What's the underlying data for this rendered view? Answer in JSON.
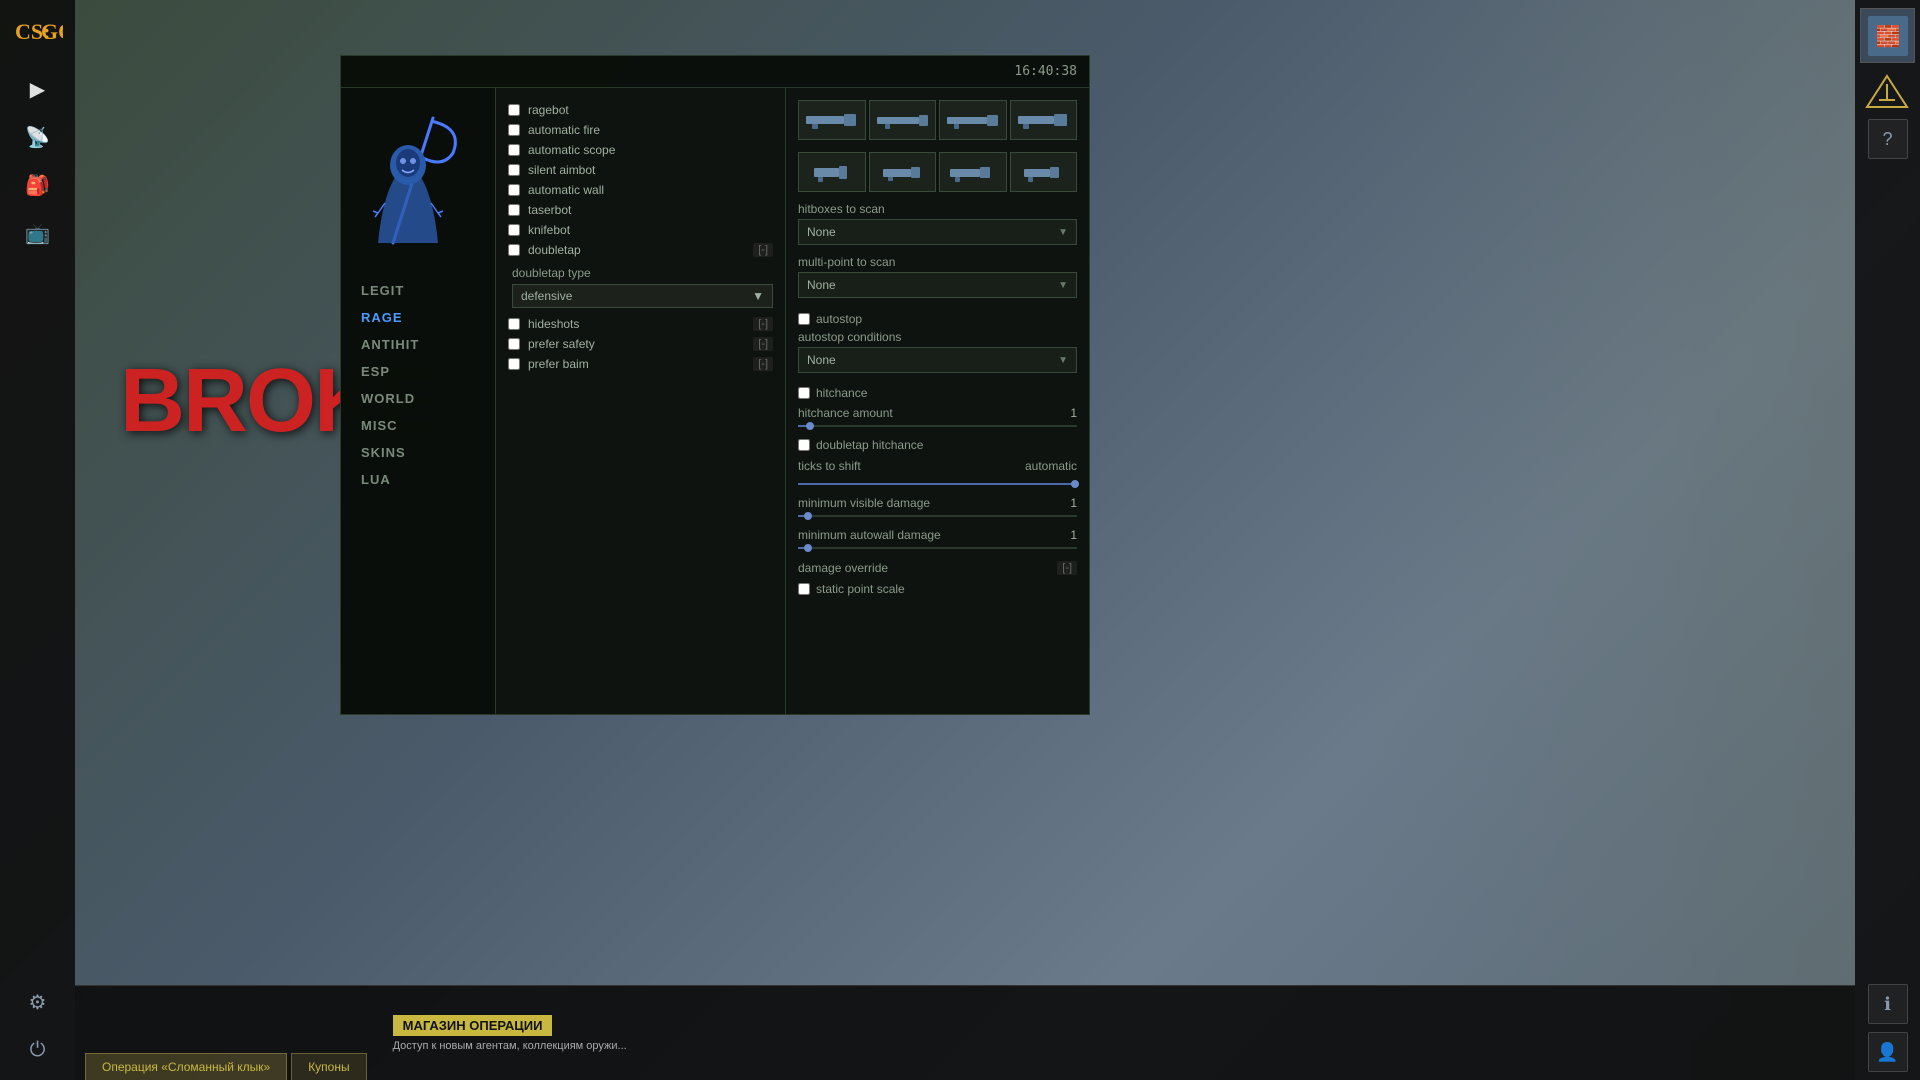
{
  "app": {
    "title": "CS:GO",
    "time": "16:40:38"
  },
  "sidebar_left": {
    "icons": [
      "▶",
      "📡",
      "🎒",
      "📺",
      "⚙",
      "⏻"
    ]
  },
  "sidebar_right": {
    "rank_icon": "≡",
    "help_icon": "?",
    "info_icon": "ℹ",
    "profile_icon": "👤"
  },
  "hacker_menu": {
    "nav": {
      "items": [
        {
          "id": "legit",
          "label": "LEGIT",
          "active": false
        },
        {
          "id": "rage",
          "label": "RAGE",
          "active": true
        },
        {
          "id": "antihit",
          "label": "ANTIHIT",
          "active": false
        },
        {
          "id": "esp",
          "label": "ESP",
          "active": false
        },
        {
          "id": "world",
          "label": "WORLD",
          "active": false
        },
        {
          "id": "misc",
          "label": "MISC",
          "active": false
        },
        {
          "id": "skins",
          "label": "SKINS",
          "active": false
        },
        {
          "id": "lua",
          "label": "LUA",
          "active": false
        }
      ]
    },
    "left_panel": {
      "checkboxes": [
        {
          "id": "ragebot",
          "label": "ragebot",
          "checked": false,
          "keybind": ""
        },
        {
          "id": "automatic_fire",
          "label": "automatic fire",
          "checked": false,
          "keybind": ""
        },
        {
          "id": "automatic_scope",
          "label": "automatic scope",
          "checked": false,
          "keybind": ""
        },
        {
          "id": "silent_aimbot",
          "label": "silent aimbot",
          "checked": false,
          "keybind": ""
        },
        {
          "id": "automatic_wall",
          "label": "automatic wall",
          "checked": false,
          "keybind": ""
        },
        {
          "id": "taserbot",
          "label": "taserbot",
          "checked": false,
          "keybind": ""
        },
        {
          "id": "knifebot",
          "label": "knifebot",
          "checked": false,
          "keybind": ""
        },
        {
          "id": "doubletap",
          "label": "doubletap",
          "checked": false,
          "keybind": "[-]"
        }
      ],
      "doubletap_type_label": "doubletap type",
      "doubletap_type_value": "defensive",
      "sub_checkboxes": [
        {
          "id": "hideshots",
          "label": "hideshots",
          "checked": false,
          "keybind": "[-]"
        },
        {
          "id": "prefer_safety",
          "label": "prefer safety",
          "checked": false,
          "keybind": "[-]"
        },
        {
          "id": "prefer_baim",
          "label": "prefer baim",
          "checked": false,
          "keybind": "[-]"
        }
      ]
    },
    "right_panel": {
      "weapons_row1": [
        {
          "id": "w1",
          "label": "rifle1",
          "active": false
        },
        {
          "id": "w2",
          "label": "rifle2",
          "active": false
        },
        {
          "id": "w3",
          "label": "rifle3",
          "active": false
        },
        {
          "id": "w4",
          "label": "rifle4",
          "active": false
        }
      ],
      "weapons_row2": [
        {
          "id": "w5",
          "label": "pistol1",
          "active": false
        },
        {
          "id": "w6",
          "label": "pistol2",
          "active": false
        },
        {
          "id": "w7",
          "label": "pistol3",
          "active": false
        },
        {
          "id": "w8",
          "label": "pistol4",
          "active": false
        }
      ],
      "hitboxes_label": "hitboxes to scan",
      "hitboxes_value": "None",
      "multipoint_label": "multi-point to scan",
      "multipoint_value": "None",
      "autostop_label": "autostop",
      "autostop_checked": false,
      "autostop_conditions_label": "autostop conditions",
      "autostop_conditions_value": "None",
      "hitchance_label": "hitchance",
      "hitchance_checked": false,
      "hitchance_amount_label": "hitchance amount",
      "hitchance_amount_value": "1",
      "doubletap_hitchance_label": "doubletap hitchance",
      "doubletap_hitchance_checked": false,
      "ticks_to_shift_label": "ticks to shift",
      "ticks_to_shift_value": "automatic",
      "minimum_visible_damage_label": "minimum visible damage",
      "minimum_visible_damage_value": "1",
      "minimum_autowall_damage_label": "minimum autowall damage",
      "minimum_autowall_damage_value": "1",
      "damage_override_label": "damage override",
      "damage_override_keybind": "[-]",
      "static_point_scale_label": "static point scale",
      "static_point_scale_checked": false
    }
  },
  "bottom_bar": {
    "tab1": "Операция «Сломанный клык»",
    "tab2": "Купоны",
    "promo_title": "МАГАЗИН ОПЕРАЦИИ",
    "promo_desc": "Доступ к новым агентам, коллекциям оружи..."
  },
  "scene": {
    "broke_text": "BROKE"
  }
}
